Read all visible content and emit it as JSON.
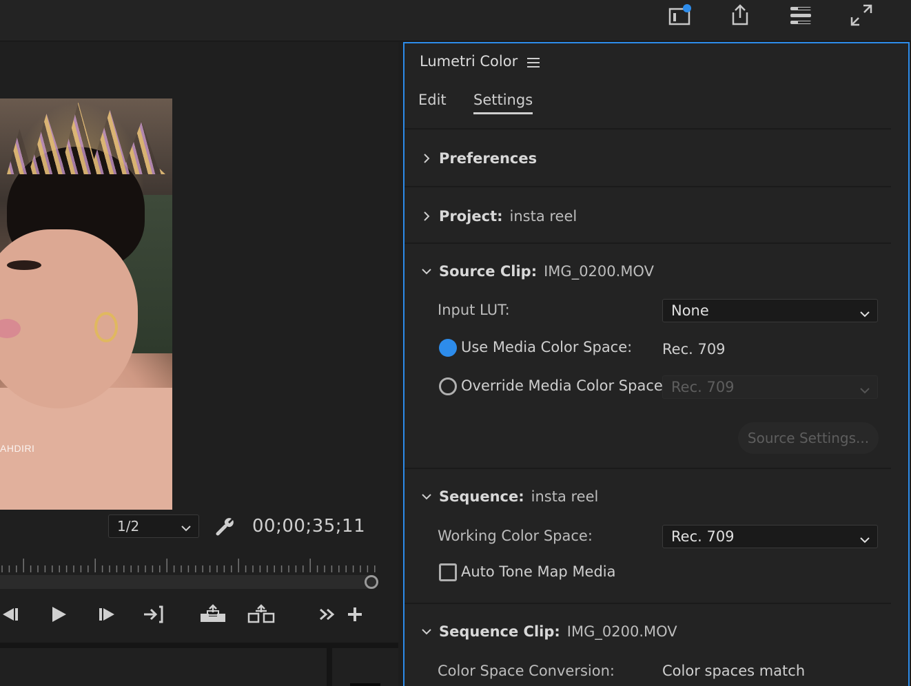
{
  "topbar": {
    "icons": [
      "layout-notification-icon",
      "export-icon",
      "workspace-menu-icon",
      "fullscreen-icon"
    ]
  },
  "monitor": {
    "watermark": "AHDIRI",
    "zoom": {
      "selected": "1/2"
    },
    "timecode": "00;00;35;11",
    "playhead_fraction": 1.0
  },
  "lumetri": {
    "title": "Lumetri Color",
    "tabs": [
      {
        "label": "Edit",
        "active": false
      },
      {
        "label": "Settings",
        "active": true
      }
    ],
    "preferences": {
      "label": "Preferences"
    },
    "project": {
      "label": "Project:",
      "value": "insta reel"
    },
    "source_clip": {
      "label": "Source Clip:",
      "value": "IMG_0200.MOV",
      "input_lut_label": "Input LUT:",
      "input_lut_value": "None",
      "use_media_label": "Use Media Color Space:",
      "use_media_value": "Rec. 709",
      "override_label": "Override Media Color Space:",
      "override_value": "Rec. 709",
      "source_settings_button": "Source Settings..."
    },
    "sequence": {
      "label": "Sequence:",
      "value": "insta reel",
      "working_cs_label": "Working Color Space:",
      "working_cs_value": "Rec. 709",
      "auto_tone_label": "Auto Tone Map Media"
    },
    "sequence_clip": {
      "label": "Sequence Clip:",
      "value": "IMG_0200.MOV",
      "conversion_label": "Color Space Conversion:",
      "conversion_value": "Color spaces match"
    }
  },
  "colors": {
    "accent": "#2d8ceb",
    "panel_bg": "#232323",
    "app_bg": "#1d1d1d"
  }
}
